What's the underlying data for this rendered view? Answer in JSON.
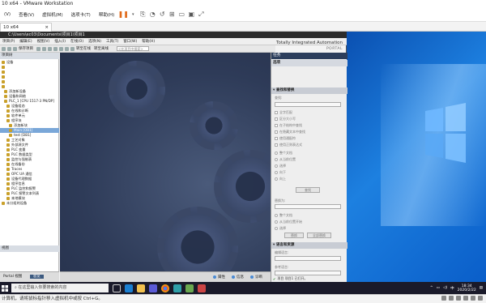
{
  "vmware": {
    "title": "10 x64 - VMware Workstation",
    "menu": [
      "(V)",
      "查看(V)",
      "虚拟机(M)",
      "选项卡(T)",
      "帮助(H)"
    ],
    "tab_label": "10 x64",
    "status_text": "计算机，请将鼠标指针移入虚拟机中或按 Ctrl+G。"
  },
  "tia": {
    "title": "C:\\Users\\ec03\\Documents\\项目1\\项目1",
    "menu": [
      "项目(P)",
      "编辑(E)",
      "视图(V)",
      "插入(I)",
      "在线(O)",
      "选项(N)",
      "工具(T)",
      "窗口(W)",
      "帮助(H)"
    ],
    "brand_line1": "Totally Integrated Automation",
    "brand_line2": "PORTAL",
    "toolbar": {
      "save_project": "保存项目",
      "go_online": "转至在线",
      "go_offline": "转至离线",
      "search_placeholder": "<在项目中搜索>"
    },
    "tree_header": "项目树",
    "tree": [
      {
        "label": "设备",
        "sel": false
      },
      {
        "label": "",
        "sel": false
      },
      {
        "label": "",
        "sel": false
      },
      {
        "label": "",
        "sel": false
      },
      {
        "label": "",
        "sel": false
      },
      {
        "label": "",
        "sel": false
      },
      {
        "label": "添加新设备",
        "sel": false
      },
      {
        "label": "设备和网络",
        "sel": false
      },
      {
        "label": "PLC_1 [CPU 1517-3 PN/DP]",
        "sel": false
      },
      {
        "label": "设备组态",
        "sel": false
      },
      {
        "label": "在线和诊断",
        "sel": false
      },
      {
        "label": "软件单元",
        "sel": false
      },
      {
        "label": "程序块",
        "sel": false
      },
      {
        "label": "添加新块",
        "sel": false
      },
      {
        "label": "Main [OB1]",
        "sel": true
      },
      {
        "label": "test [DB1]",
        "sel": false
      },
      {
        "label": "工艺对象",
        "sel": false
      },
      {
        "label": "外部源文件",
        "sel": false
      },
      {
        "label": "PLC 变量",
        "sel": false
      },
      {
        "label": "PLC 数据类型",
        "sel": false
      },
      {
        "label": "监控与强制表",
        "sel": false
      },
      {
        "label": "在线备份",
        "sel": false
      },
      {
        "label": "Traces",
        "sel": false
      },
      {
        "label": "OPC UA 通信",
        "sel": false
      },
      {
        "label": "设备代理数据",
        "sel": false
      },
      {
        "label": "程序信息",
        "sel": false
      },
      {
        "label": "PLC 监控和报警",
        "sel": false
      },
      {
        "label": "PLC 报警文本列表",
        "sel": false
      },
      {
        "label": "本地模块",
        "sel": false
      },
      {
        "label": "未分组的设备",
        "sel": false
      }
    ],
    "detail_header": "视图",
    "portal_view": "Portal 视图",
    "overview": "总览",
    "status": {
      "properties": "属性",
      "info": "信息",
      "diagnostics": "诊断"
    },
    "task_panel": {
      "header": "任务",
      "options": "选项",
      "find_replace": "查找和替换",
      "find_label": "查找:",
      "checkboxes": [
        "全字匹配",
        "区分大小写",
        "在子结构中查找",
        "在隐藏文本中查找",
        "使用通配符",
        "使用正则表达式"
      ],
      "direction": [
        "整个文档",
        "从当前位置",
        "选择"
      ],
      "dir_radios": [
        "向下",
        "向上"
      ],
      "find_button": "查找",
      "replace_label": "替换为:",
      "replace_radios": [
        "整个文档",
        "从当前位置开始",
        "选择"
      ],
      "replace_button": "替换",
      "replace_all_button": "全部替换",
      "languages": "语言和资源",
      "edit_lang": "编辑语言:",
      "ref_lang": "参考语言:",
      "bottom_line": "项目 项目1 已打开。"
    }
  },
  "taskbar": {
    "search_placeholder": "在这里输入你要搜索的内容",
    "time": "18:34",
    "date": "2020/2/22"
  }
}
